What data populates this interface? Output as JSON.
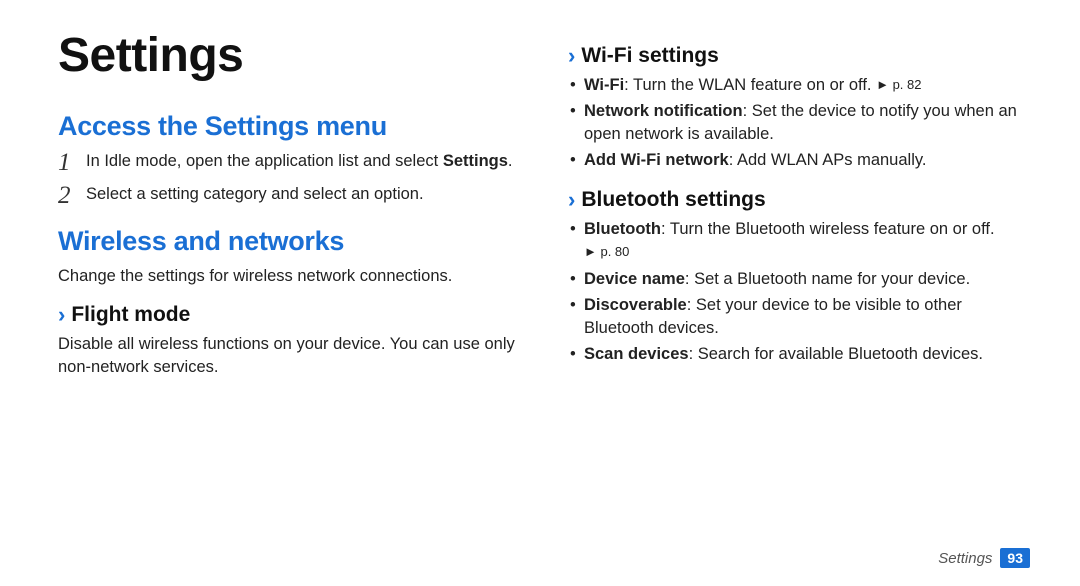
{
  "title": "Settings",
  "left": {
    "section_access": "Access the Settings menu",
    "step1_a": "In Idle mode, open the application list and select ",
    "step1_b": "Settings",
    "step1_c": ".",
    "step2": "Select a setting category and select an option.",
    "section_wireless": "Wireless and networks",
    "wireless_desc": "Change the settings for wireless network connections.",
    "flight_heading": "Flight mode",
    "flight_desc": "Disable all wireless functions on your device. You can use only non-network services."
  },
  "right": {
    "wifi_heading": "Wi-Fi settings",
    "wifi": {
      "item1_b": "Wi-Fi",
      "item1_t": ": Turn the WLAN feature on or off. ",
      "item1_ref": "► p. 82",
      "item2_b": "Network notification",
      "item2_t": ": Set the device to notify you when an open network is available.",
      "item3_b": "Add Wi-Fi network",
      "item3_t": ": Add WLAN APs manually."
    },
    "bt_heading": "Bluetooth settings",
    "bt": {
      "item1_b": "Bluetooth",
      "item1_t": ": Turn the Bluetooth wireless feature on or off. ",
      "item1_ref": "► p. 80",
      "item2_b": "Device name",
      "item2_t": ": Set a Bluetooth name for your device.",
      "item3_b": "Discoverable",
      "item3_t": ": Set your device to be visible to other Bluetooth devices.",
      "item4_b": "Scan devices",
      "item4_t": ": Search for available Bluetooth devices."
    }
  },
  "footer": {
    "label": "Settings",
    "page": "93"
  }
}
